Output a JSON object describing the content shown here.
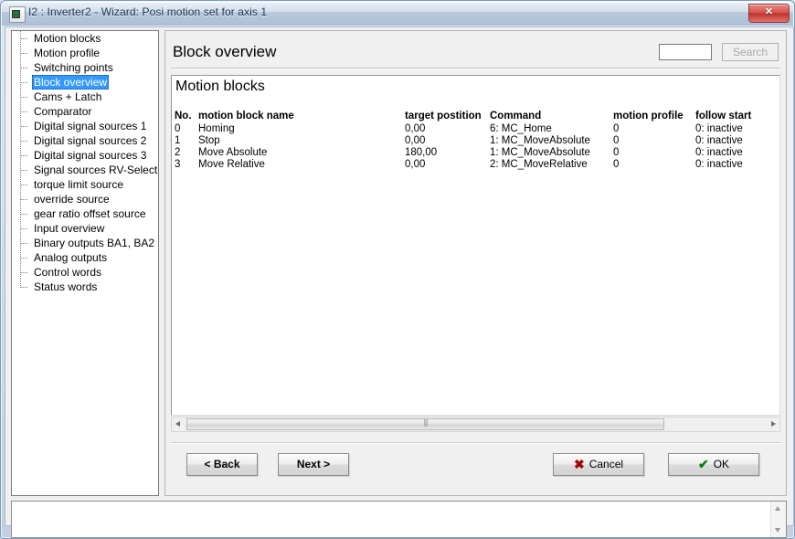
{
  "window": {
    "title": "I2 : Inverter2 - Wizard: Posi motion set for axis 1",
    "close_label": "Close",
    "app_icon": "application-icon"
  },
  "sidebar": {
    "items": [
      {
        "label": "Motion blocks",
        "selected": false
      },
      {
        "label": "Motion profile",
        "selected": false
      },
      {
        "label": "Switching points",
        "selected": false
      },
      {
        "label": "Block overview",
        "selected": true
      },
      {
        "label": "Cams + Latch",
        "selected": false
      },
      {
        "label": "Comparator",
        "selected": false
      },
      {
        "label": "Digital signal sources 1",
        "selected": false
      },
      {
        "label": "Digital signal sources 2",
        "selected": false
      },
      {
        "label": "Digital signal sources 3",
        "selected": false
      },
      {
        "label": "Signal sources RV-Select",
        "selected": false
      },
      {
        "label": "torque limit source",
        "selected": false
      },
      {
        "label": "override source",
        "selected": false
      },
      {
        "label": "gear ratio offset source",
        "selected": false
      },
      {
        "label": "Input overview",
        "selected": false
      },
      {
        "label": "Binary outputs BA1, BA2",
        "selected": false
      },
      {
        "label": "Analog outputs",
        "selected": false
      },
      {
        "label": "Control words",
        "selected": false
      },
      {
        "label": "Status words",
        "selected": false
      }
    ]
  },
  "main": {
    "page_title": "Block overview",
    "search": {
      "value": "",
      "placeholder": "",
      "button_label": "Search",
      "button_enabled": false
    },
    "group_title": "Motion blocks",
    "table": {
      "columns": [
        "No.",
        "motion block name",
        "target postition",
        "Command",
        "motion profile",
        "follow start"
      ],
      "rows": [
        {
          "no": "0",
          "name": "Homing",
          "target": "0,00",
          "command": "6: MC_Home",
          "profile": "0",
          "follow": "0: inactive"
        },
        {
          "no": "1",
          "name": "Stop",
          "target": "0,00",
          "command": "1: MC_MoveAbsolute",
          "profile": "0",
          "follow": "0: inactive"
        },
        {
          "no": "2",
          "name": "Move Absolute",
          "target": "180,00",
          "command": "1: MC_MoveAbsolute",
          "profile": "0",
          "follow": "0: inactive"
        },
        {
          "no": "3",
          "name": "Move Relative",
          "target": "0,00",
          "command": "2: MC_MoveRelative",
          "profile": "0",
          "follow": "0: inactive"
        }
      ]
    },
    "scrollbar": {
      "left_arrow": "scroll-left-arrow",
      "right_arrow": "scroll-right-arrow",
      "grip": "|||"
    }
  },
  "footer": {
    "back_label": "< Back",
    "next_label": "Next >",
    "cancel_label": "Cancel",
    "ok_label": "OK",
    "cancel_icon": "✖",
    "ok_icon": "✔"
  },
  "log_pane": {
    "text": ""
  },
  "colors": {
    "selection": "#3399ff",
    "cancel_icon": "#a00808",
    "ok_icon": "#008000",
    "titlebar": "#acc0d6",
    "client_bg": "#f0f0f0"
  }
}
